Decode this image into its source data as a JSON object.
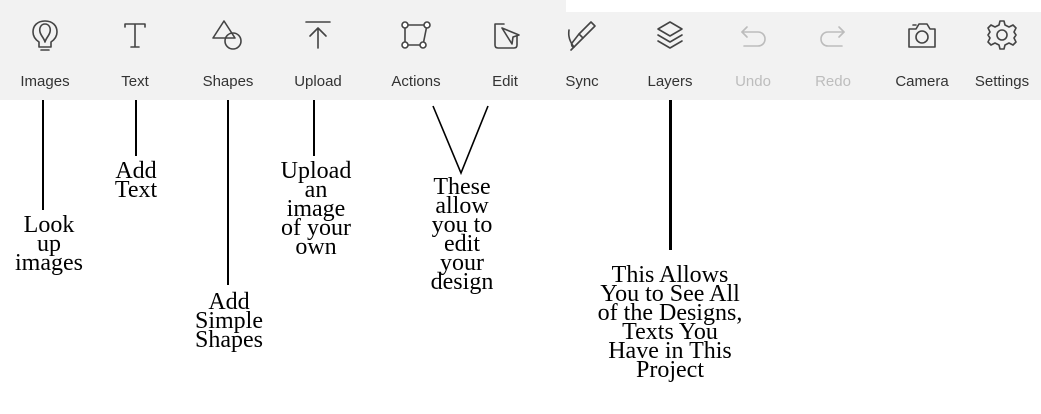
{
  "toolbar": {
    "images": "Images",
    "text": "Text",
    "shapes": "Shapes",
    "upload": "Upload",
    "actions": "Actions",
    "edit": "Edit",
    "sync": "Sync",
    "layers": "Layers",
    "undo": "Undo",
    "redo": "Redo",
    "camera": "Camera",
    "settings": "Settings"
  },
  "annotations": {
    "look_up_images": [
      "Look",
      "up",
      "images"
    ],
    "add_text": [
      "Add",
      "Text"
    ],
    "add_shapes": [
      "Add",
      "Simple",
      "Shapes"
    ],
    "upload_image": [
      "Upload",
      "an",
      "image",
      "of your",
      "own"
    ],
    "edit_design": [
      "These",
      "allow",
      "you to",
      "edit",
      "your",
      "design"
    ],
    "layers_info": [
      "This Allows",
      "You to See All",
      "of the Designs,",
      "Texts You",
      "Have in This",
      "Project"
    ]
  },
  "colors": {
    "toolbar_bg": "#f2f2f2",
    "icon": "#444444",
    "disabled": "#bcbcbc"
  }
}
